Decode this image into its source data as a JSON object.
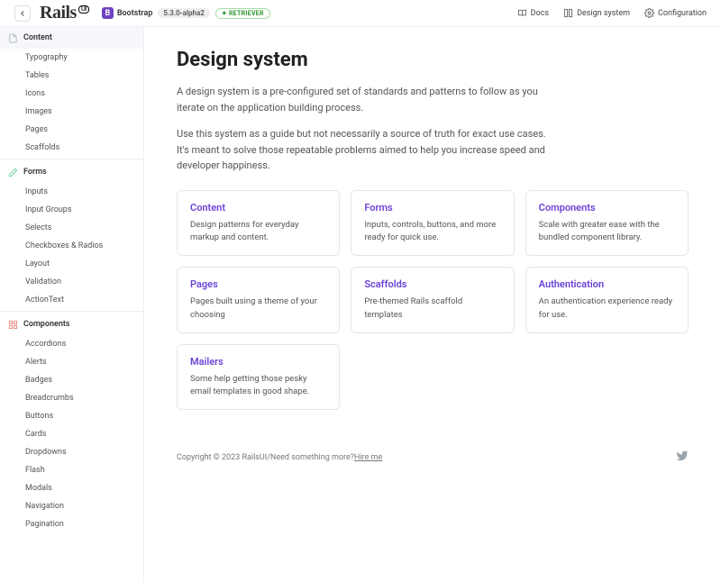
{
  "topbar": {
    "logo_text": "Rails",
    "logo_badge": "UI",
    "brand": "Bootstrap",
    "version": "5.3.0-alpha2",
    "theme_name": "RETRIEVER",
    "nav": {
      "docs": "Docs",
      "design_system": "Design system",
      "configuration": "Configuration"
    }
  },
  "sidebar": {
    "content": {
      "label": "Content",
      "items": [
        "Typography",
        "Tables",
        "Icons",
        "Images",
        "Pages",
        "Scaffolds"
      ]
    },
    "forms": {
      "label": "Forms",
      "items": [
        "Inputs",
        "Input Groups",
        "Selects",
        "Checkboxes & Radios",
        "Layout",
        "Validation",
        "ActionText"
      ]
    },
    "components": {
      "label": "Components",
      "items": [
        "Accordions",
        "Alerts",
        "Badges",
        "Breadcrumbs",
        "Buttons",
        "Cards",
        "Dropdowns",
        "Flash",
        "Modals",
        "Navigation",
        "Pagination"
      ]
    }
  },
  "page": {
    "title": "Design system",
    "intro1": "A design system is a pre-configured set of standards and patterns to follow as you iterate on the application building process.",
    "intro2": "Use this system as a guide but not necessarily a source of truth for exact use cases. It's meant to solve those repeatable problems aimed to help you increase speed and developer happiness.",
    "cards": [
      {
        "title": "Content",
        "desc": "Design patterns for everyday markup and content."
      },
      {
        "title": "Forms",
        "desc": "Inputs, controls, buttons, and more ready for quick use."
      },
      {
        "title": "Components",
        "desc": "Scale with greater ease with the bundled component library."
      },
      {
        "title": "Pages",
        "desc": "Pages built using a theme of your choosing"
      },
      {
        "title": "Scaffolds",
        "desc": "Pre-themed Rails scaffold templates"
      },
      {
        "title": "Authentication",
        "desc": "An authentication experience ready for use."
      },
      {
        "title": "Mailers",
        "desc": "Some help getting those pesky email templates in good shape."
      }
    ]
  },
  "footer": {
    "copyright": "Copyright © 2023 RailsUI",
    "sep": "  /  ",
    "prompt": "Need something more? ",
    "link": "Hire me"
  }
}
